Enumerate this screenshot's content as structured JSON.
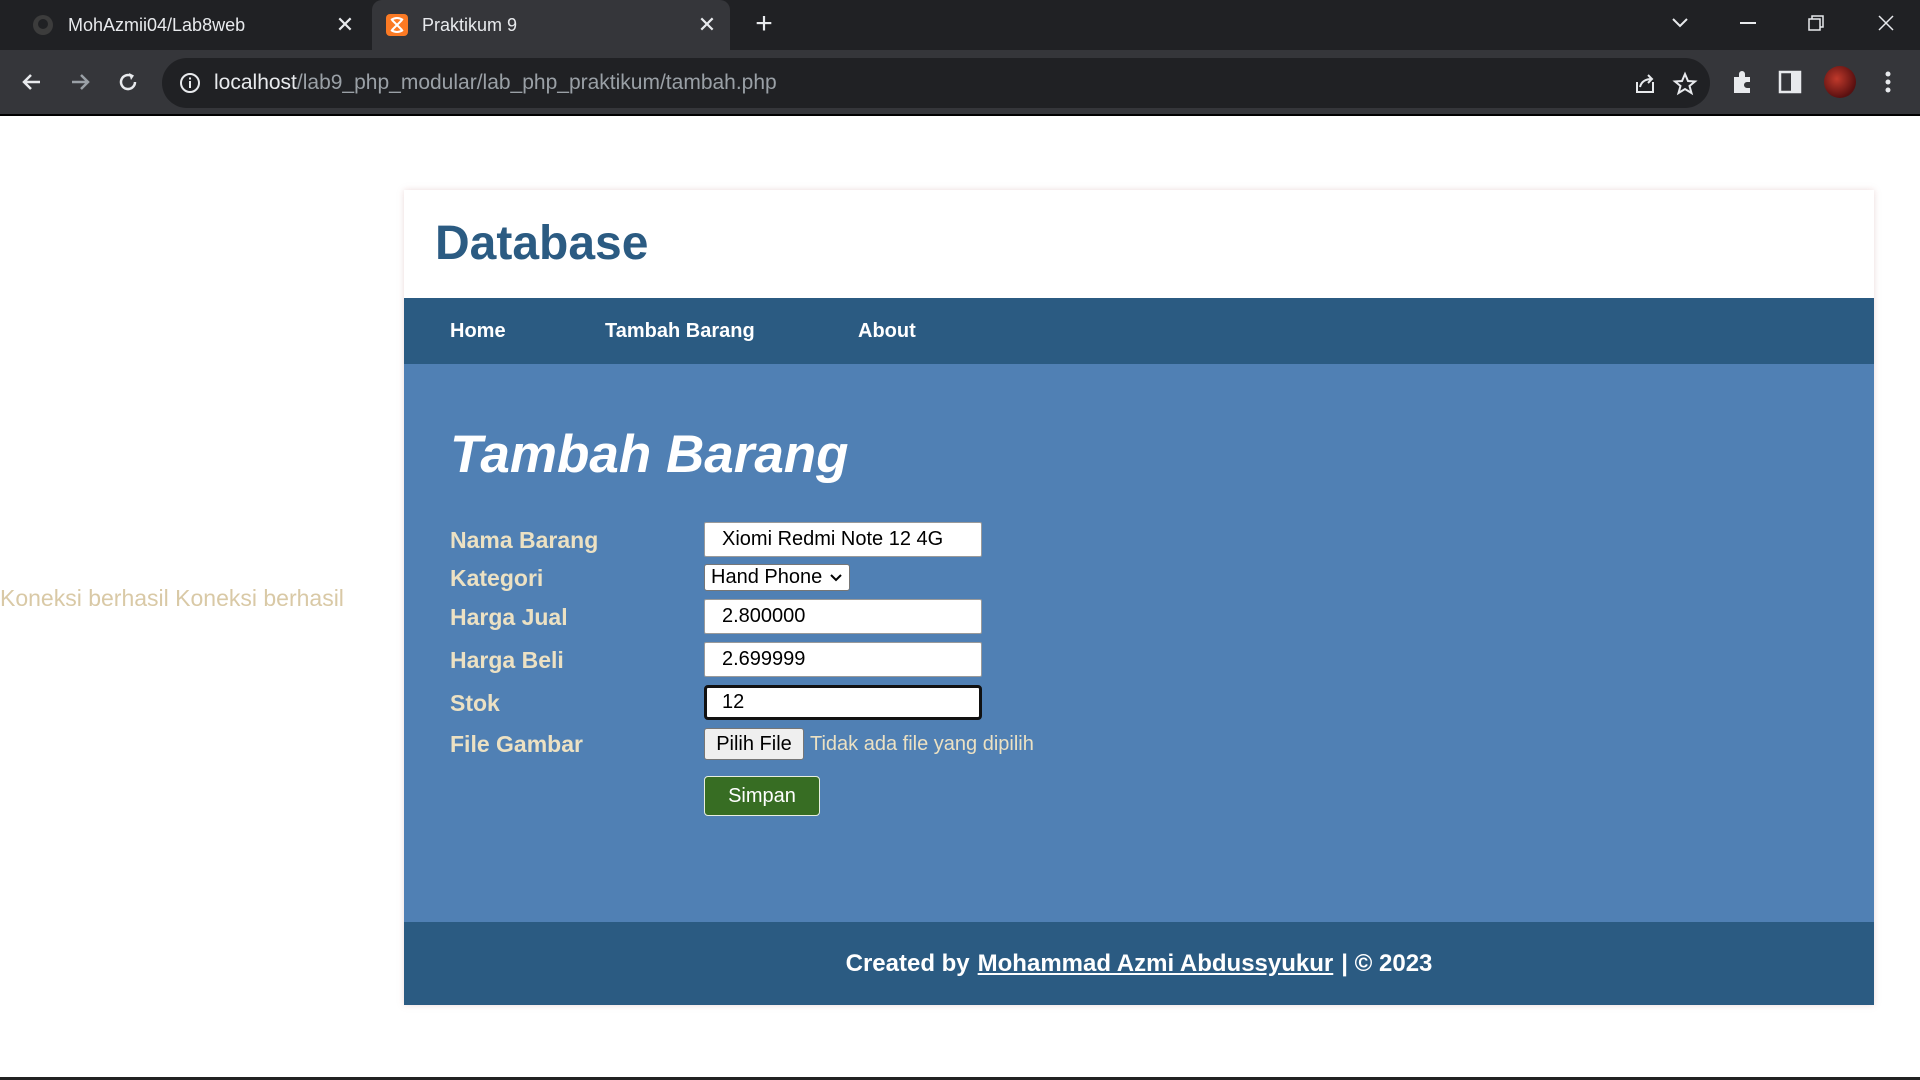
{
  "browser": {
    "tabs": [
      {
        "title": "MohAzmii04/Lab8web",
        "icon": "github-icon",
        "active": false
      },
      {
        "title": "Praktikum 9",
        "icon": "xampp-icon",
        "active": true
      }
    ],
    "url_host": "localhost",
    "url_path": "/lab9_php_modular/lab_php_praktikum/tambah.php"
  },
  "connection_message": "Koneksi berhasil Koneksi berhasil",
  "header": {
    "title": "Database"
  },
  "nav": {
    "home": "Home",
    "tambah": "Tambah Barang",
    "about": "About"
  },
  "form": {
    "heading": "Tambah Barang",
    "nama_label": "Nama Barang",
    "nama_value": "Xiomi Redmi Note 12 4G",
    "kategori_label": "Kategori",
    "kategori_value": "Hand Phone",
    "harga_jual_label": "Harga Jual",
    "harga_jual_value": "2.800000",
    "harga_beli_label": "Harga Beli",
    "harga_beli_value": "2.699999",
    "stok_label": "Stok",
    "stok_value": "12",
    "gambar_label": "File Gambar",
    "file_button": "Pilih File",
    "file_status": "Tidak ada file yang dipilih",
    "submit_label": "Simpan"
  },
  "footer": {
    "prefix": "Created by",
    "author": "Mohammad Azmi Abdussyukur",
    "suffix": "| © 2023"
  },
  "colors": {
    "header_text": "#2b5b82",
    "nav_bg": "#2b5b82",
    "main_bg": "#5080b4",
    "label_text": "#ece1c3",
    "submit_bg": "#376d23"
  }
}
